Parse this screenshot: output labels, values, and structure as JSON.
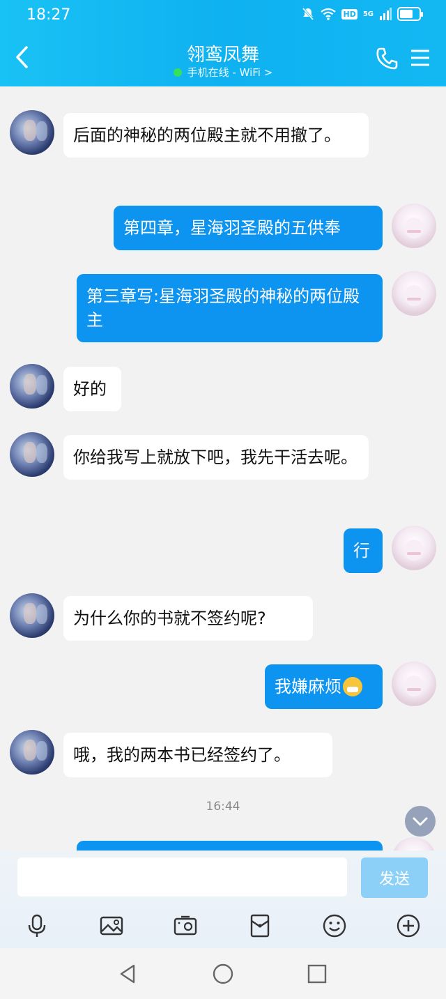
{
  "status_bar": {
    "time": "18:27",
    "hd": "HD",
    "network": "5G"
  },
  "header": {
    "title": "翎鸾凤舞",
    "subtitle": "手机在线 - WiFi >"
  },
  "messages": [
    {
      "side": "in",
      "text": "后面的神秘的两位殿主就不用撤了。"
    },
    {
      "side": "out",
      "text": "第四章，星海羽圣殿的五供奉"
    },
    {
      "side": "out",
      "text": "第三章写:星海羽圣殿的神秘的两位殿主"
    },
    {
      "side": "in",
      "text": "好的"
    },
    {
      "side": "in",
      "text": "你给我写上就放下吧，我先干活去呢。"
    },
    {
      "side": "out",
      "text": "行"
    },
    {
      "side": "in",
      "text": "为什么你的书就不签约呢?"
    },
    {
      "side": "out",
      "text": "我嫌麻烦",
      "emoji": "mask-emoji"
    },
    {
      "side": "in",
      "text": "哦，我的两本书已经签约了。"
    }
  ],
  "timestamp": "16:44",
  "composer": {
    "placeholder": "",
    "send_label": "发送"
  },
  "toolbar": [
    "microphone-icon",
    "image-icon",
    "camera-icon",
    "red-packet-icon",
    "emoji-icon",
    "plus-icon"
  ],
  "colors": {
    "header": "#13b8f3",
    "out_bubble": "#0d93f0",
    "in_bubble": "#ffffff",
    "send_button": "#8dd0f7"
  }
}
